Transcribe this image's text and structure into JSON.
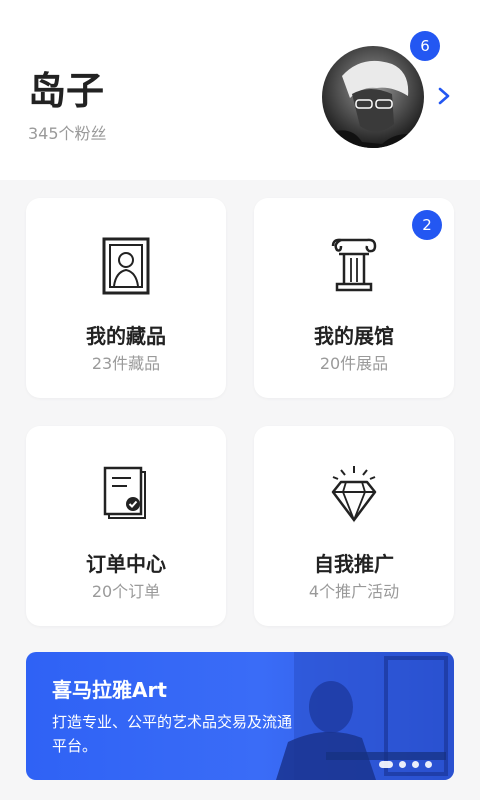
{
  "profile": {
    "name": "岛子",
    "fans": "345个粉丝",
    "notification_count": "6"
  },
  "cards": [
    {
      "title": "我的藏品",
      "subtitle": "23件藏品",
      "icon": "framed-painting-icon"
    },
    {
      "title": "我的展馆",
      "subtitle": "20件展品",
      "icon": "column-icon",
      "badge": "2"
    },
    {
      "title": "订单中心",
      "subtitle": "20个订单",
      "icon": "order-document-icon"
    },
    {
      "title": "自我推广",
      "subtitle": "4个推广活动",
      "icon": "diamond-icon"
    }
  ],
  "banner": {
    "title": "喜马拉雅Art",
    "description": "打造专业、公平的艺术品交易及流通平台。",
    "slide_count": 4,
    "active_slide": 1
  },
  "colors": {
    "accent": "#2357f2",
    "background": "#f6f6f7",
    "text_primary": "#222222",
    "text_secondary": "#9a9a9a"
  }
}
